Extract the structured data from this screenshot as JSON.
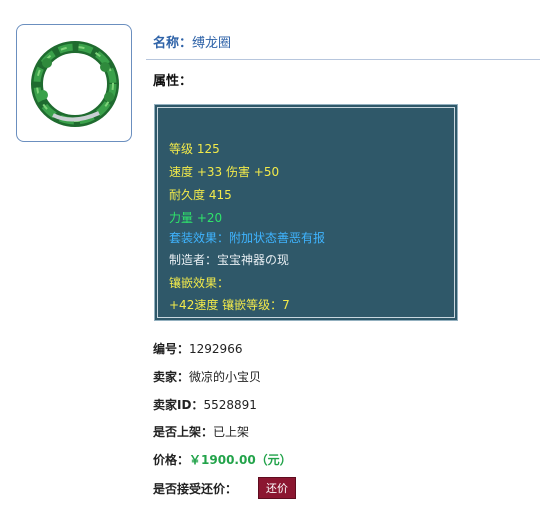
{
  "item": {
    "name_label": "名称：",
    "name_value": "缚龙圈",
    "attr_label": "属性："
  },
  "stats": {
    "level": "等级 125",
    "speed_damage": "速度 +33 伤害 +50",
    "durability": "耐久度 415",
    "strength": "力量 +20",
    "set_effect": "套装效果：附加状态善恶有报",
    "maker": "制造者：宝宝神器の现",
    "inlay_label": "镶嵌效果：",
    "inlay_value": "+42速度 镶嵌等级：7"
  },
  "info": {
    "id_label": "编号：",
    "id_value": "1292966",
    "seller_label": "卖家：",
    "seller_value": "微凉的小宝贝",
    "seller_id_label": "卖家ID：",
    "seller_id_value": "5528891",
    "listed_label": "是否上架：",
    "listed_value": "已上架",
    "price_label": "价格：",
    "price_value": "￥1900.00（元）",
    "counter_label": "是否接受还价：",
    "counter_button": "还价"
  },
  "colors": {
    "stats_bg": "#2f5869",
    "yellow": "#f2ea4a",
    "green": "#2fe36a",
    "blue": "#3fb4ff",
    "price": "#22a34a",
    "button": "#8b1630"
  },
  "icons": {
    "item": "green-vine-ring-icon"
  }
}
